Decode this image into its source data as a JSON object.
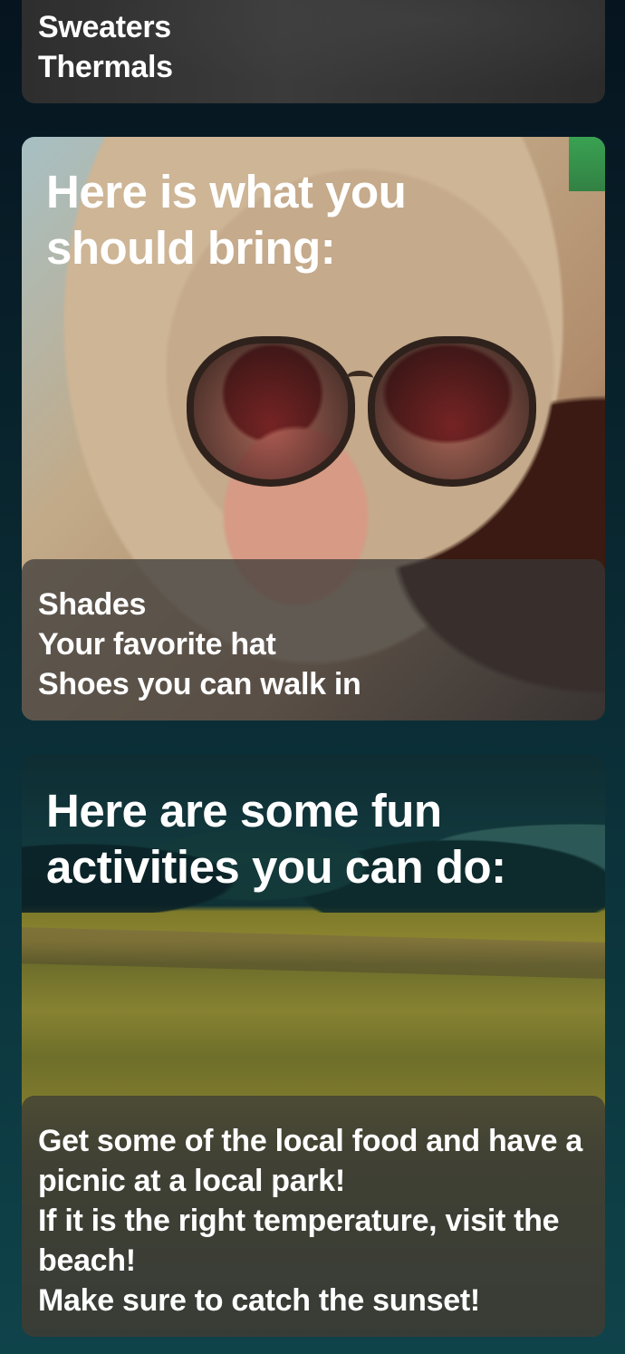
{
  "cards": [
    {
      "title": "",
      "items": [
        "Sweaters",
        "Thermals"
      ]
    },
    {
      "title": "Here is what you should bring:",
      "items": [
        "Shades",
        "Your favorite hat",
        "Shoes you can walk in"
      ]
    },
    {
      "title": "Here are some fun activities you can do:",
      "items": [
        "Get some of the local food and have a picnic at a local park!",
        "If it is the right temperature, visit the beach!",
        "Make sure to catch the sunset!"
      ]
    }
  ],
  "colors": {
    "page_background_top": "#06141f",
    "page_background_bottom": "#0f434a",
    "overlay": "rgba(55,55,55,0.72)",
    "text": "#ffffff"
  }
}
